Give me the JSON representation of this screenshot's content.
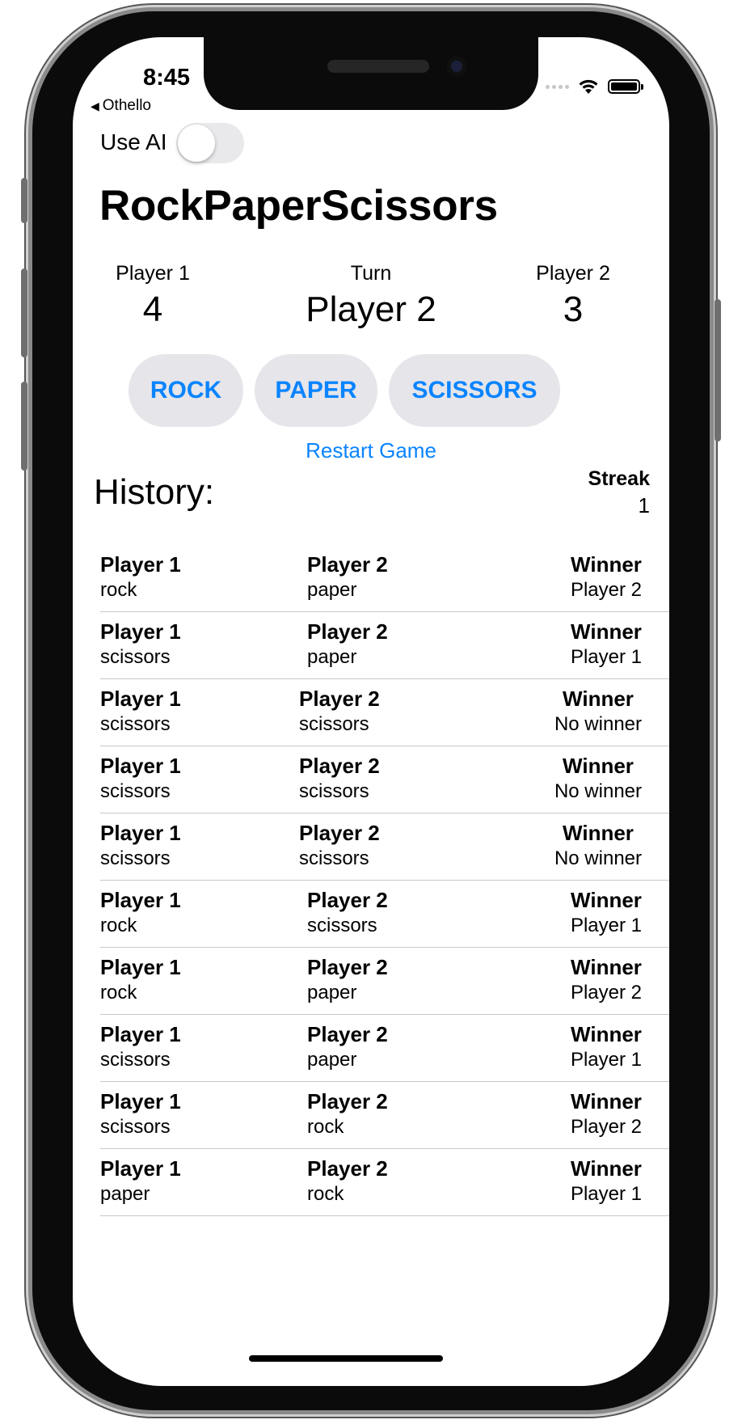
{
  "status_bar": {
    "time": "8:45",
    "back_label": "Othello"
  },
  "use_ai": {
    "label": "Use AI",
    "on": false
  },
  "title": "RockPaperScissors",
  "scoreboard": {
    "player1_label": "Player 1",
    "player1_score": "4",
    "turn_label": "Turn",
    "turn_value": "Player 2",
    "player2_label": "Player 2",
    "player2_score": "3"
  },
  "choices": {
    "rock": "ROCK",
    "paper": "PAPER",
    "scissors": "SCISSORS"
  },
  "restart_label": "Restart Game",
  "history": {
    "label": "History:",
    "streak_label": "Streak",
    "streak_value": "1",
    "rows": [
      {
        "p1_label": "Player 1",
        "p1": "rock",
        "p2_label": "Player 2",
        "p2": "paper",
        "winner_label": "Winner",
        "winner": "Player 2"
      },
      {
        "p1_label": "Player 1",
        "p1": "scissors",
        "p2_label": "Player 2",
        "p2": "paper",
        "winner_label": "Winner",
        "winner": "Player 1"
      },
      {
        "p1_label": "Player 1",
        "p1": "scissors",
        "p2_label": "Player 2",
        "p2": "scissors",
        "winner_label": "Winner",
        "winner": "No winner"
      },
      {
        "p1_label": "Player 1",
        "p1": "scissors",
        "p2_label": "Player 2",
        "p2": "scissors",
        "winner_label": "Winner",
        "winner": "No winner"
      },
      {
        "p1_label": "Player 1",
        "p1": "scissors",
        "p2_label": "Player 2",
        "p2": "scissors",
        "winner_label": "Winner",
        "winner": "No winner"
      },
      {
        "p1_label": "Player 1",
        "p1": "rock",
        "p2_label": "Player 2",
        "p2": "scissors",
        "winner_label": "Winner",
        "winner": "Player 1"
      },
      {
        "p1_label": "Player 1",
        "p1": "rock",
        "p2_label": "Player 2",
        "p2": "paper",
        "winner_label": "Winner",
        "winner": "Player 2"
      },
      {
        "p1_label": "Player 1",
        "p1": "scissors",
        "p2_label": "Player 2",
        "p2": "paper",
        "winner_label": "Winner",
        "winner": "Player 1"
      },
      {
        "p1_label": "Player 1",
        "p1": "scissors",
        "p2_label": "Player 2",
        "p2": "rock",
        "winner_label": "Winner",
        "winner": "Player 2"
      },
      {
        "p1_label": "Player 1",
        "p1": "paper",
        "p2_label": "Player 2",
        "p2": "rock",
        "winner_label": "Winner",
        "winner": "Player 1"
      }
    ]
  },
  "colors": {
    "accent": "#0a84ff",
    "button_bg": "#e5e5ea",
    "separator": "#c8c7cc"
  }
}
